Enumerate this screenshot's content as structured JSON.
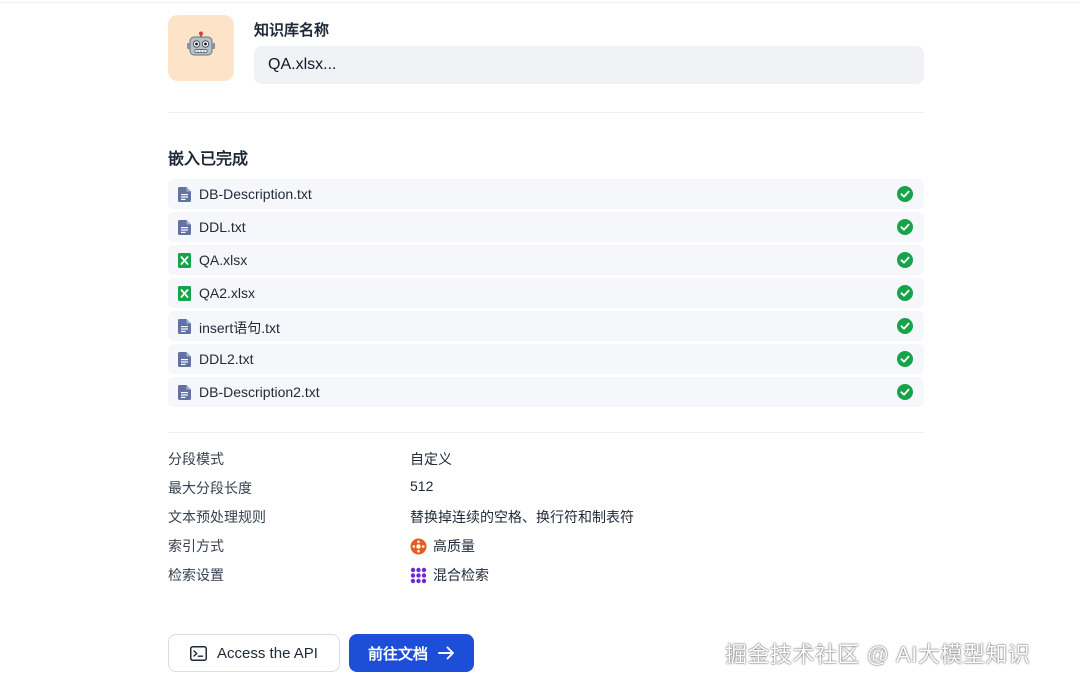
{
  "knowledge_base": {
    "name_label": "知识库名称",
    "name_value": "QA.xlsx...",
    "avatar_icon": "robot-icon"
  },
  "embedding": {
    "title": "嵌入已完成",
    "files": [
      {
        "name": "DB-Description.txt",
        "type": "text-file-icon",
        "status": "completed"
      },
      {
        "name": "DDL.txt",
        "type": "text-file-icon",
        "status": "completed"
      },
      {
        "name": "QA.xlsx",
        "type": "excel-file-icon",
        "status": "completed"
      },
      {
        "name": "QA2.xlsx",
        "type": "excel-file-icon",
        "status": "completed"
      },
      {
        "name": "insert语句.txt",
        "type": "text-file-icon",
        "status": "completed"
      },
      {
        "name": "DDL2.txt",
        "type": "text-file-icon",
        "status": "completed"
      },
      {
        "name": "DB-Description2.txt",
        "type": "text-file-icon",
        "status": "completed"
      }
    ]
  },
  "settings": [
    {
      "label": "分段模式",
      "value": "自定义",
      "icon": ""
    },
    {
      "label": "最大分段长度",
      "value": "512",
      "icon": ""
    },
    {
      "label": "文本预处理规则",
      "value": "替换掉连续的空格、换行符和制表符",
      "icon": ""
    },
    {
      "label": "索引方式",
      "value": "高质量",
      "icon": "high-quality-icon"
    },
    {
      "label": "检索设置",
      "value": "混合检索",
      "icon": "hybrid-search-icon"
    }
  ],
  "buttons": {
    "api_label": "Access the API",
    "docs_label": "前往文档"
  },
  "watermark": "掘金技术社区 @ AI大模型知识",
  "colors": {
    "primary": "#1d4ed8",
    "success": "#16a34a",
    "avatar_bg": "#fde3c8",
    "row_bg": "#f6f7fb",
    "excel": "#16a34a",
    "text_file": "#6272a4"
  }
}
